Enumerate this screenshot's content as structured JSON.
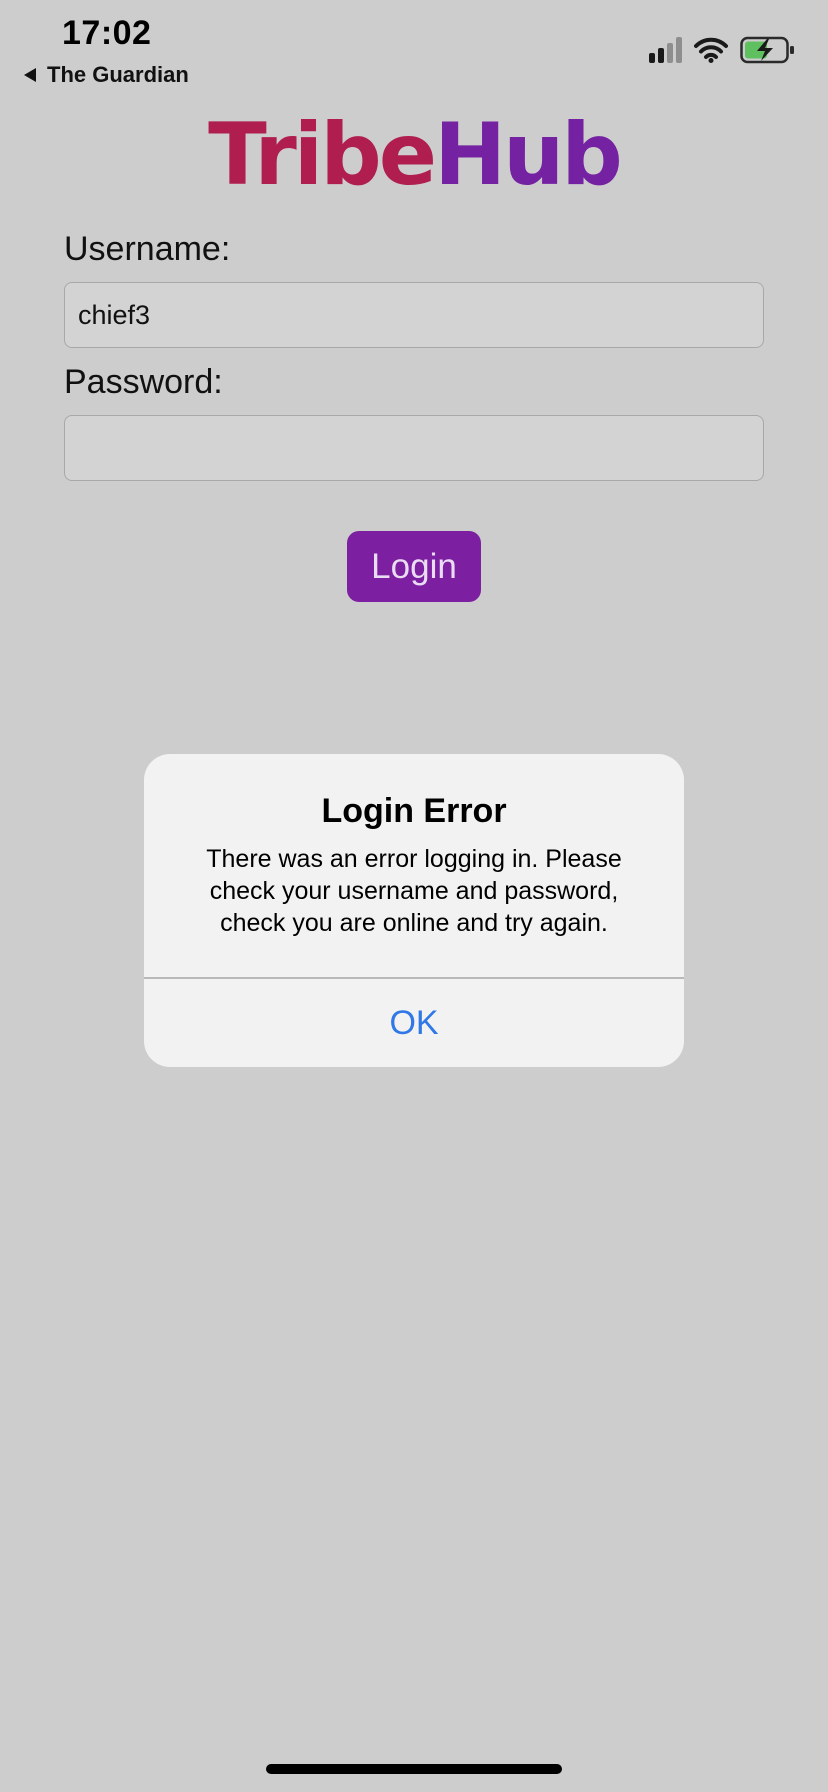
{
  "status_bar": {
    "time": "17:02",
    "back_app": "The Guardian",
    "icons": [
      "cellular-signal-icon",
      "wifi-icon",
      "battery-charging-icon"
    ],
    "battery_color": "#5fc05f"
  },
  "app": {
    "logo_part_a": "Tribe",
    "logo_part_b": "Hub",
    "logo_color_a": "#b01e50",
    "logo_color_b": "#7421a2"
  },
  "form": {
    "username_label": "Username:",
    "username_value": "chief3",
    "password_label": "Password:",
    "password_value": "",
    "login_label": "Login",
    "login_color": "#7c1fa0"
  },
  "alert": {
    "title": "Login Error",
    "message": "There was an error logging in. Please check your username and password, check you are online and try again.",
    "ok_label": "OK",
    "ok_color": "#2f78e6"
  }
}
